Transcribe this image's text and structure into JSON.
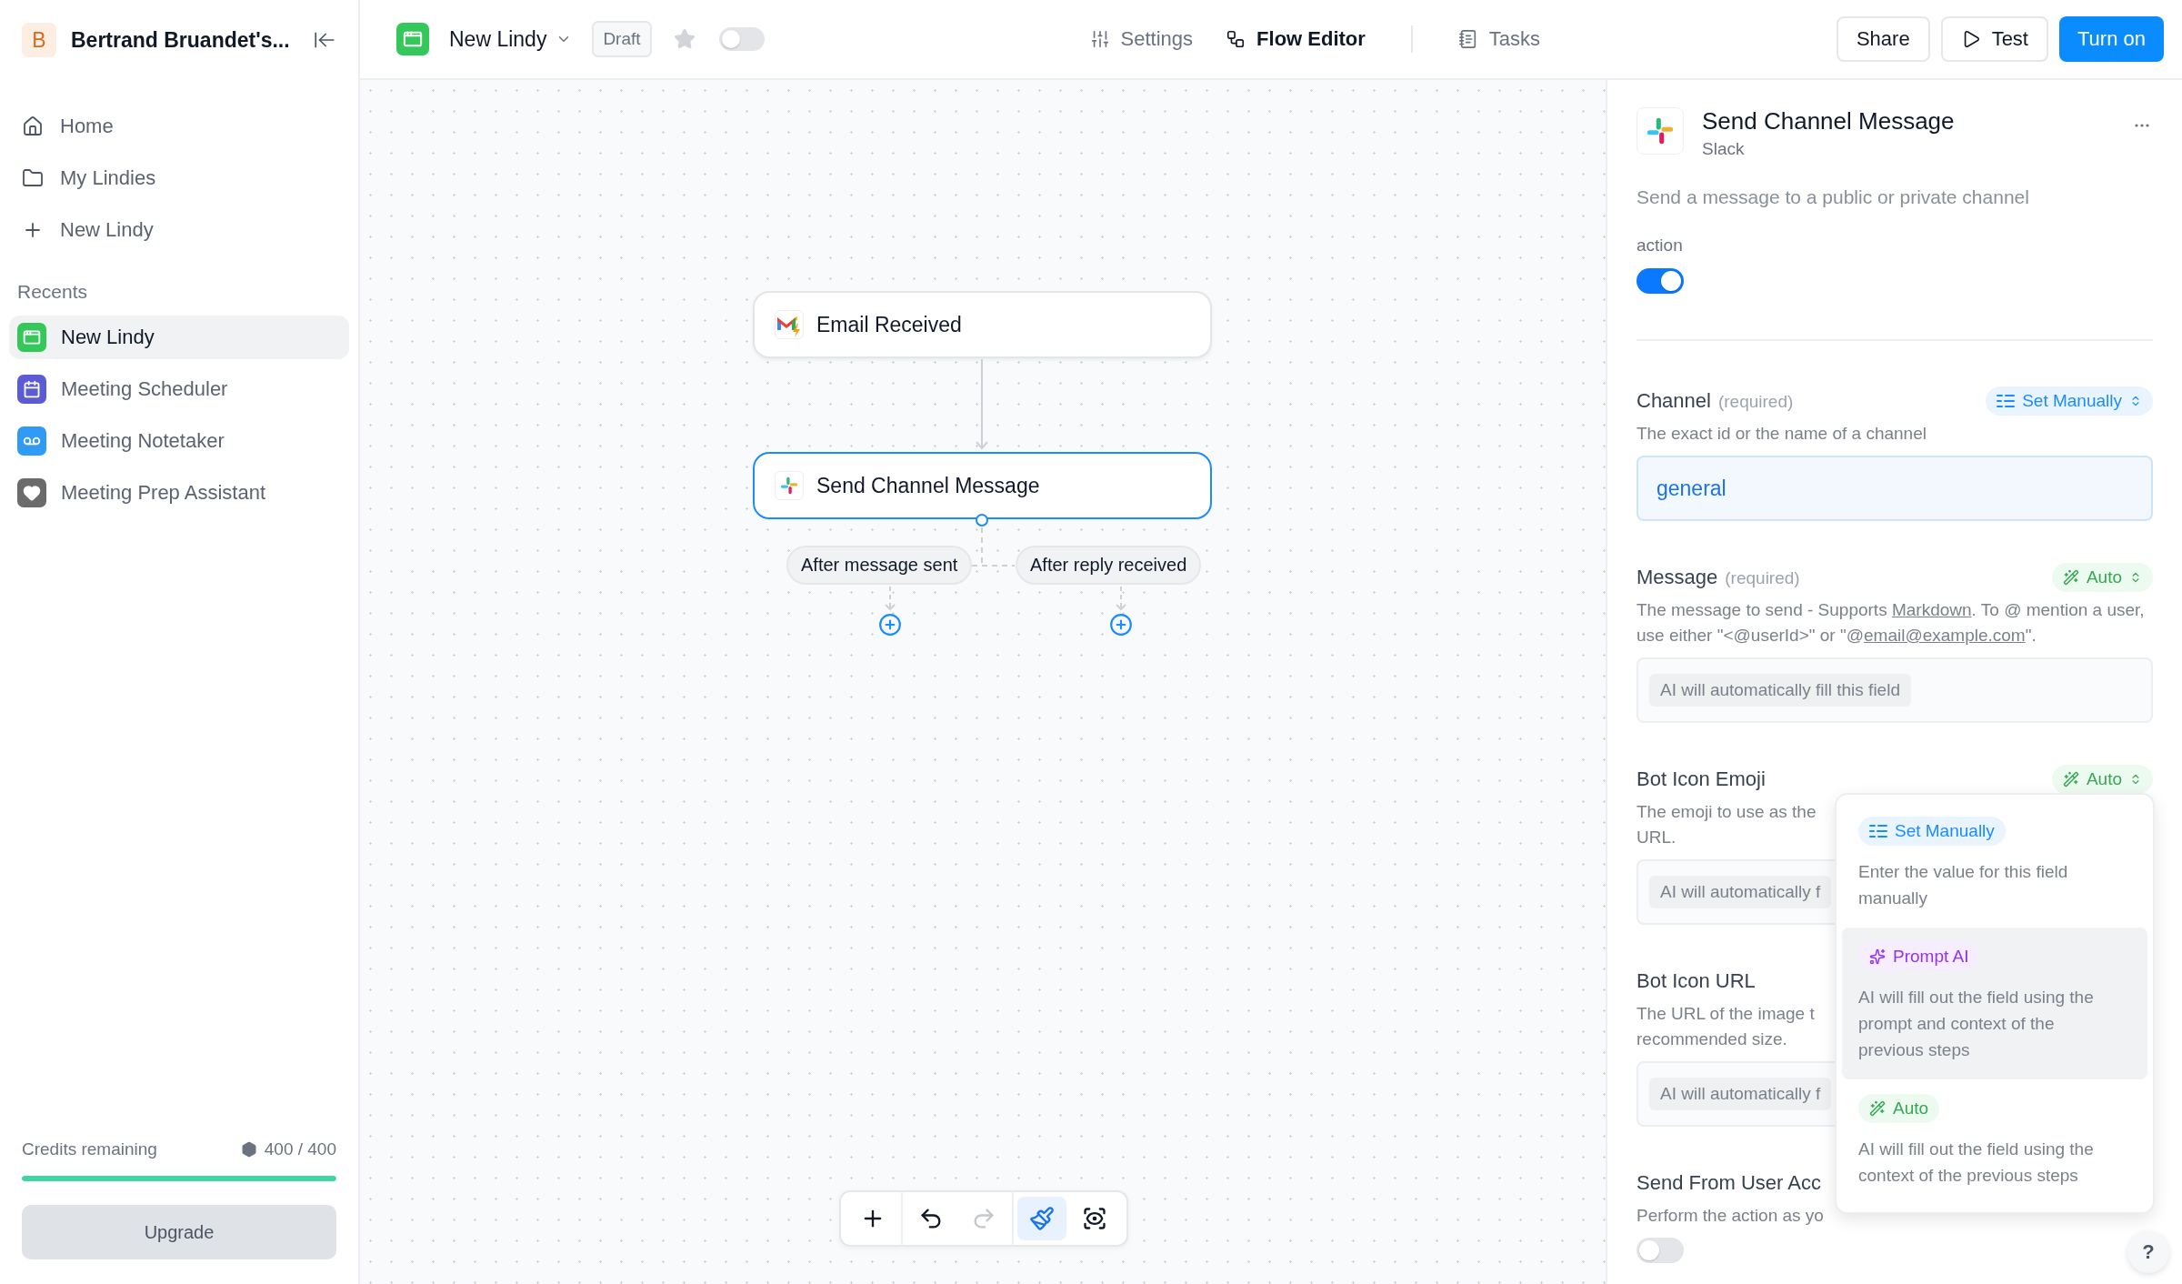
{
  "sidebar": {
    "workspace": {
      "initial": "B",
      "name": "Bertrand Bruandet's..."
    },
    "nav": [
      {
        "kind": "home",
        "label": "Home"
      },
      {
        "kind": "folder",
        "label": "My Lindies"
      },
      {
        "kind": "new",
        "label": "New Lindy"
      }
    ],
    "recents_label": "Recents",
    "recents": [
      {
        "kind": "window",
        "label": "New Lindy",
        "color": "#34c759",
        "selected": true
      },
      {
        "kind": "calendar",
        "label": "Meeting Scheduler",
        "color": "#5b5bd6",
        "selected": false
      },
      {
        "kind": "voicemail",
        "label": "Meeting Notetaker",
        "color": "#2f9bf5",
        "selected": false
      },
      {
        "kind": "heart",
        "label": "Meeting Prep Assistant",
        "color": "#6b6b6b",
        "selected": false
      }
    ],
    "credits": {
      "label": "Credits remaining",
      "reading": "400 / 400",
      "level": 1
    },
    "upgrade": "Upgrade"
  },
  "topbar": {
    "app_name": "New Lindy",
    "status": "Draft",
    "starred": false,
    "enabled": false,
    "tabs": [
      {
        "kind": "settings",
        "label": "Settings",
        "selected": false
      },
      {
        "kind": "flow",
        "label": "Flow Editor",
        "selected": true
      },
      {
        "kind": "tasks",
        "label": "Tasks",
        "selected": false
      }
    ],
    "buttons": [
      {
        "kind": "secondary",
        "label": "Share"
      },
      {
        "kind": "play",
        "label": "Test"
      },
      {
        "kind": "primary",
        "label": "Turn on"
      }
    ]
  },
  "canvas": {
    "nodes": [
      {
        "kind": "gmail",
        "label": "Email Received",
        "selected": false
      },
      {
        "kind": "slack",
        "label": "Send Channel Message",
        "selected": true
      }
    ],
    "branches": [
      {
        "label": "After message sent"
      },
      {
        "label": "After reply received"
      }
    ],
    "tools": [
      {
        "kind": "add",
        "active": false,
        "disabled": false
      },
      {
        "kind": "undo",
        "active": false,
        "disabled": false
      },
      {
        "kind": "redo",
        "active": false,
        "disabled": true
      },
      {
        "kind": "tidy",
        "active": true,
        "disabled": false
      },
      {
        "kind": "focus",
        "active": false,
        "disabled": false
      }
    ]
  },
  "panel": {
    "title": "Send Channel Message",
    "app": "Slack",
    "description": "Send a message to a public or private channel",
    "action": {
      "label": "action",
      "on": true
    },
    "fields": [
      {
        "kind": "value",
        "label": "Channel",
        "required": "(required)",
        "mode": {
          "kind": "manual",
          "label": "Set Manually"
        },
        "description": [
          {
            "kind": "text",
            "text": "The exact id or the name of a channel"
          }
        ],
        "value": "general"
      },
      {
        "kind": "auto",
        "label": "Message",
        "required": "(required)",
        "mode": {
          "kind": "auto",
          "label": "Auto"
        },
        "description": [
          {
            "kind": "text",
            "text": "The message to send - Supports "
          },
          {
            "kind": "link",
            "text": "Markdown"
          },
          {
            "kind": "text",
            "text": ". To @ mention a user, use either \"<@userId>\" or \"@"
          },
          {
            "kind": "link",
            "text": "email@example.com"
          },
          {
            "kind": "text",
            "text": "\"."
          }
        ],
        "note": "AI will automatically fill this field"
      },
      {
        "kind": "auto",
        "label": "Bot Icon Emoji",
        "mode": {
          "kind": "auto",
          "label": "Auto"
        },
        "description": [
          {
            "kind": "text",
            "text": "The emoji to use as the"
          },
          {
            "kind": "break"
          },
          {
            "kind": "text",
            "text": "URL."
          }
        ],
        "note": "AI will automatically f"
      },
      {
        "kind": "auto",
        "label": "Bot Icon URL",
        "description": [
          {
            "kind": "text",
            "text": "The URL of the image t"
          },
          {
            "kind": "break"
          },
          {
            "kind": "text",
            "text": "recommended size."
          }
        ],
        "note": "AI will automatically f"
      },
      {
        "kind": "toggle",
        "label": "Send From User Acc",
        "description": [
          {
            "kind": "text",
            "text": "Perform the action as yo"
          }
        ],
        "on": false
      }
    ],
    "mode_menu": {
      "options": [
        {
          "kind": "manual",
          "label": "Set Manually",
          "text": "Enter the value for this field manually",
          "highlighted": false
        },
        {
          "kind": "prompt",
          "label": "Prompt AI",
          "text": "AI will fill out the field using the prompt and context of the previous steps",
          "highlighted": true
        },
        {
          "kind": "auto",
          "label": "Auto",
          "text": "AI will fill out the field using the context of the previous steps",
          "highlighted": false
        }
      ]
    },
    "help": "?"
  }
}
